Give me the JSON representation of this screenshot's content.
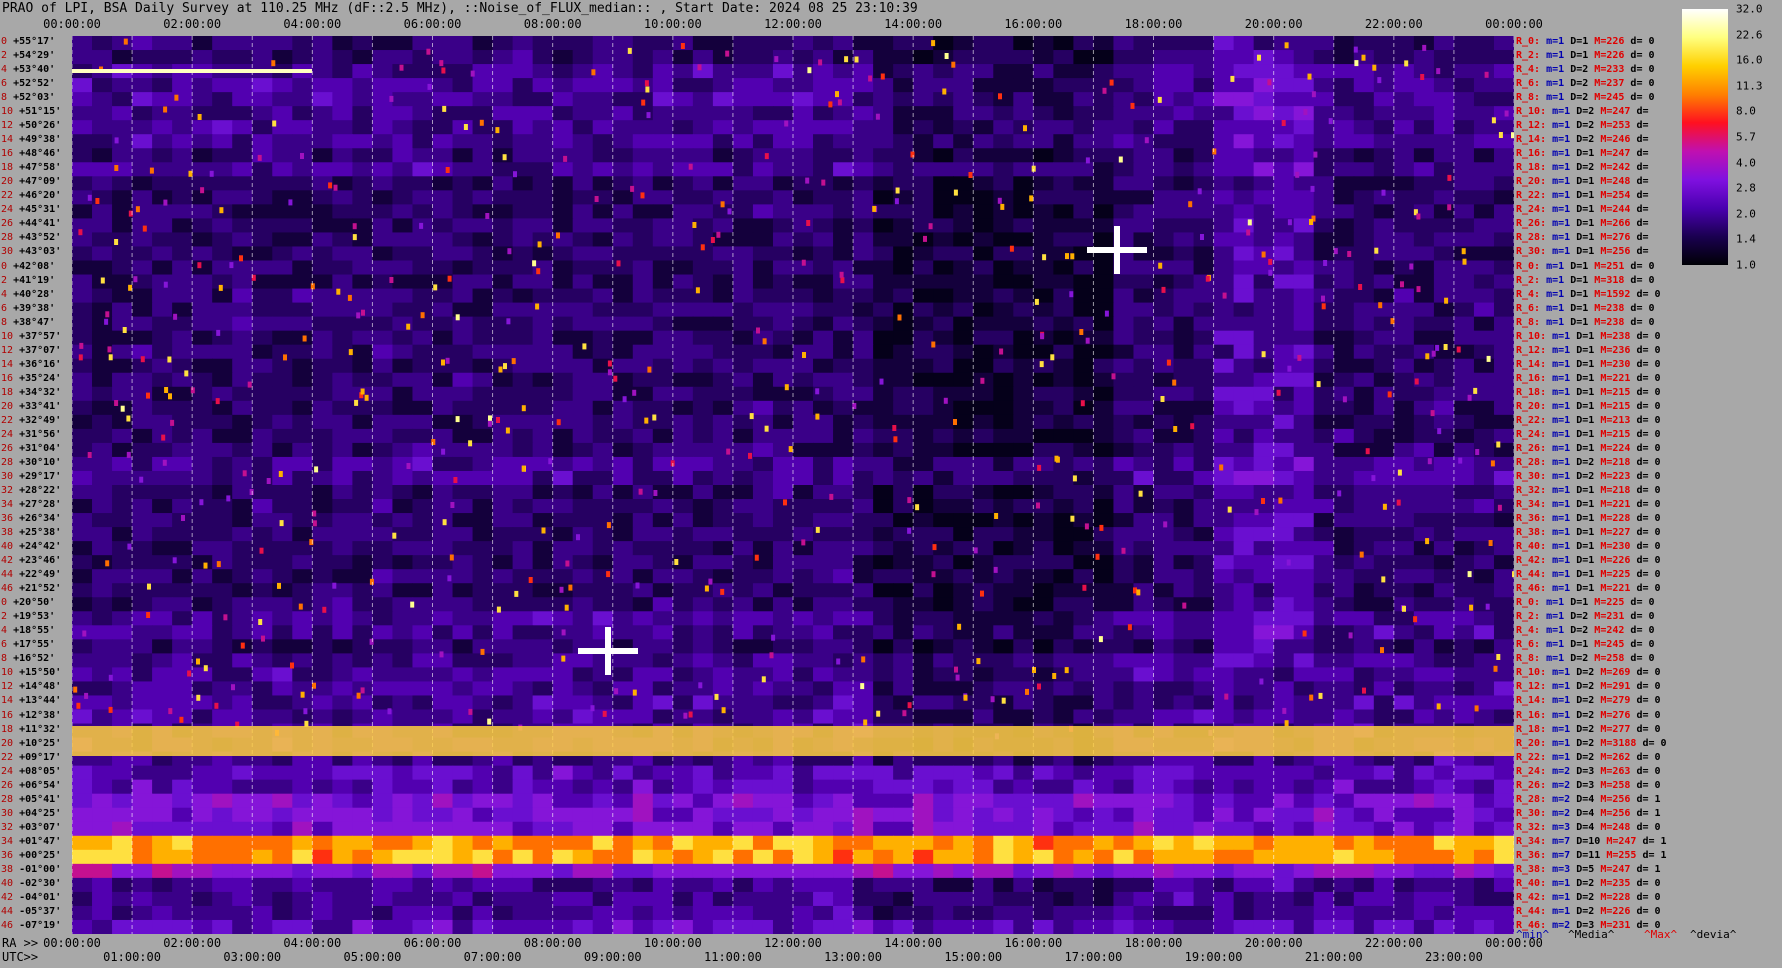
{
  "title": "PRAO of LPI, BSA Daily Survey at 110.25 MHz (dF::2.5 MHz), ::Noise_of_FLUX_median:: , Start Date: 2024 08 25 23:10:39",
  "ra_prefix": "RA >>",
  "utc_prefix": "UTC>>",
  "top_ticks": [
    "00:00:00",
    "02:00:00",
    "04:00:00",
    "06:00:00",
    "08:00:00",
    "10:00:00",
    "12:00:00",
    "14:00:00",
    "16:00:00",
    "18:00:00",
    "20:00:00",
    "22:00:00",
    "00:00:00"
  ],
  "ra_ticks": [
    "00:00:00",
    "02:00:00",
    "04:00:00",
    "06:00:00",
    "08:00:00",
    "10:00:00",
    "12:00:00",
    "14:00:00",
    "16:00:00",
    "18:00:00",
    "20:00:00",
    "22:00:00",
    "00:00:00"
  ],
  "utc_ticks": [
    "01:00:00",
    "03:00:00",
    "05:00:00",
    "07:00:00",
    "09:00:00",
    "11:00:00",
    "13:00:00",
    "15:00:00",
    "17:00:00",
    "19:00:00",
    "21:00:00",
    "23:00:00"
  ],
  "colorbar": {
    "labels": [
      "32.0",
      "22.6",
      "16.0",
      "11.3",
      "8.0",
      "5.7",
      "4.0",
      "2.8",
      "2.0",
      "1.4",
      "1.0"
    ]
  },
  "legend": {
    "min": "^min^",
    "median": "^Media^",
    "max": "^Max^",
    "devia": "^devia^"
  },
  "chart_data": {
    "type": "heatmap",
    "title": "PRAO of LPI, BSA Daily Survey at 110.25 MHz (dF::2.5 MHz), ::Noise_of_FLUX_median:: , Start Date: 2024 08 25 23:10:39",
    "x_axis": "RA / UTC",
    "dec_labels": [
      "+55°17'",
      "+54°29'",
      "+53°40'",
      "+52°52'",
      "+52°03'",
      "+51°15'",
      "+50°26'",
      "+49°38'",
      "+48°46'",
      "+47°58'",
      "+47°09'",
      "+46°20'",
      "+45°31'",
      "+44°41'",
      "+43°52'",
      "+43°03'",
      "+42°08'",
      "+41°19'",
      "+40°28'",
      "+39°38'",
      "+38°47'",
      "+37°57'",
      "+37°07'",
      "+36°16'",
      "+35°24'",
      "+34°32'",
      "+33°41'",
      "+32°49'",
      "+31°56'",
      "+31°04'",
      "+30°10'",
      "+29°17'",
      "+28°22'",
      "+27°28'",
      "+26°34'",
      "+25°38'",
      "+24°42'",
      "+23°46'",
      "+22°49'",
      "+21°52'",
      "+20°50'",
      "+19°53'",
      "+18°55'",
      "+17°55'",
      "+16°52'",
      "+15°50'",
      "+14°48'",
      "+13°44'",
      "+12°38'",
      "+11°32'",
      "+10°25'",
      "+09°17'",
      "+08°05'",
      "+06°54'",
      "+05°41'",
      "+04°25'",
      "+03°07'",
      "+01°47'",
      "+00°25'",
      "-01°00'",
      "-02°30'",
      "-04°01'",
      "-05°37'",
      "-07°19'"
    ],
    "row_indices": [
      "0",
      "2",
      "4",
      "6",
      "8",
      "10",
      "12",
      "14",
      "16",
      "18",
      "20",
      "22",
      "24",
      "26",
      "28",
      "30",
      "0",
      "2",
      "4",
      "6",
      "8",
      "10",
      "12",
      "14",
      "16",
      "18",
      "20",
      "22",
      "24",
      "26",
      "28",
      "30",
      "32",
      "34",
      "36",
      "38",
      "40",
      "42",
      "44",
      "46",
      "0",
      "2",
      "4",
      "6",
      "8",
      "10",
      "12",
      "14",
      "16",
      "18",
      "20",
      "22",
      "24",
      "26",
      "28",
      "30",
      "32",
      "34",
      "36",
      "38",
      "40",
      "42",
      "44",
      "46"
    ],
    "colorbar_values": [
      32.0,
      22.6,
      16.0,
      11.3,
      8.0,
      5.7,
      4.0,
      2.8,
      2.0,
      1.4,
      1.0
    ],
    "row_stats": [
      {
        "r": "R_0:",
        "m": 1,
        "D": 1,
        "M": 226,
        "d": "0"
      },
      {
        "r": "R_2:",
        "m": 1,
        "D": 1,
        "M": 226,
        "d": "0"
      },
      {
        "r": "R_4:",
        "m": 1,
        "D": 2,
        "M": 233,
        "d": "0"
      },
      {
        "r": "R_6:",
        "m": 1,
        "D": 2,
        "M": 237,
        "d": "0"
      },
      {
        "r": "R_8:",
        "m": 1,
        "D": 2,
        "M": 245,
        "d": "0"
      },
      {
        "r": "R_10:",
        "m": 1,
        "D": 2,
        "M": 247,
        "d": ""
      },
      {
        "r": "R_12:",
        "m": 1,
        "D": 2,
        "M": 253,
        "d": ""
      },
      {
        "r": "R_14:",
        "m": 1,
        "D": 2,
        "M": 246,
        "d": ""
      },
      {
        "r": "R_16:",
        "m": 1,
        "D": 1,
        "M": 247,
        "d": ""
      },
      {
        "r": "R_18:",
        "m": 1,
        "D": 2,
        "M": 242,
        "d": ""
      },
      {
        "r": "R_20:",
        "m": 1,
        "D": 1,
        "M": 248,
        "d": ""
      },
      {
        "r": "R_22:",
        "m": 1,
        "D": 1,
        "M": 254,
        "d": ""
      },
      {
        "r": "R_24:",
        "m": 1,
        "D": 1,
        "M": 244,
        "d": ""
      },
      {
        "r": "R_26:",
        "m": 1,
        "D": 1,
        "M": 266,
        "d": ""
      },
      {
        "r": "R_28:",
        "m": 1,
        "D": 1,
        "M": 276,
        "d": ""
      },
      {
        "r": "R_30:",
        "m": 1,
        "D": 1,
        "M": 256,
        "d": ""
      },
      {
        "r": "R_0:",
        "m": 1,
        "D": 1,
        "M": 251,
        "d": "0"
      },
      {
        "r": "R_2:",
        "m": 1,
        "D": 1,
        "M": 318,
        "d": "0"
      },
      {
        "r": "R_4:",
        "m": 1,
        "D": 1,
        "M": 1592,
        "d": "0"
      },
      {
        "r": "R_6:",
        "m": 1,
        "D": 1,
        "M": 238,
        "d": "0"
      },
      {
        "r": "R_8:",
        "m": 1,
        "D": 1,
        "M": 238,
        "d": "0"
      },
      {
        "r": "R_10:",
        "m": 1,
        "D": 1,
        "M": 238,
        "d": "0"
      },
      {
        "r": "R_12:",
        "m": 1,
        "D": 1,
        "M": 236,
        "d": "0"
      },
      {
        "r": "R_14:",
        "m": 1,
        "D": 1,
        "M": 230,
        "d": "0"
      },
      {
        "r": "R_16:",
        "m": 1,
        "D": 1,
        "M": 221,
        "d": "0"
      },
      {
        "r": "R_18:",
        "m": 1,
        "D": 1,
        "M": 215,
        "d": "0"
      },
      {
        "r": "R_20:",
        "m": 1,
        "D": 1,
        "M": 215,
        "d": "0"
      },
      {
        "r": "R_22:",
        "m": 1,
        "D": 1,
        "M": 213,
        "d": "0"
      },
      {
        "r": "R_24:",
        "m": 1,
        "D": 1,
        "M": 215,
        "d": "0"
      },
      {
        "r": "R_26:",
        "m": 1,
        "D": 1,
        "M": 224,
        "d": "0"
      },
      {
        "r": "R_28:",
        "m": 1,
        "D": 2,
        "M": 218,
        "d": "0"
      },
      {
        "r": "R_30:",
        "m": 1,
        "D": 2,
        "M": 223,
        "d": "0"
      },
      {
        "r": "R_32:",
        "m": 1,
        "D": 1,
        "M": 218,
        "d": "0"
      },
      {
        "r": "R_34:",
        "m": 1,
        "D": 1,
        "M": 221,
        "d": "0"
      },
      {
        "r": "R_36:",
        "m": 1,
        "D": 1,
        "M": 228,
        "d": "0"
      },
      {
        "r": "R_38:",
        "m": 1,
        "D": 1,
        "M": 227,
        "d": "0"
      },
      {
        "r": "R_40:",
        "m": 1,
        "D": 1,
        "M": 230,
        "d": "0"
      },
      {
        "r": "R_42:",
        "m": 1,
        "D": 1,
        "M": 226,
        "d": "0"
      },
      {
        "r": "R_44:",
        "m": 1,
        "D": 1,
        "M": 225,
        "d": "0"
      },
      {
        "r": "R_46:",
        "m": 1,
        "D": 1,
        "M": 221,
        "d": "0"
      },
      {
        "r": "R_0:",
        "m": 1,
        "D": 1,
        "M": 225,
        "d": "0"
      },
      {
        "r": "R_2:",
        "m": 1,
        "D": 2,
        "M": 231,
        "d": "0"
      },
      {
        "r": "R_4:",
        "m": 1,
        "D": 2,
        "M": 242,
        "d": "0"
      },
      {
        "r": "R_6:",
        "m": 1,
        "D": 1,
        "M": 245,
        "d": "0"
      },
      {
        "r": "R_8:",
        "m": 1,
        "D": 2,
        "M": 258,
        "d": "0"
      },
      {
        "r": "R_10:",
        "m": 1,
        "D": 2,
        "M": 269,
        "d": "0"
      },
      {
        "r": "R_12:",
        "m": 1,
        "D": 2,
        "M": 291,
        "d": "0"
      },
      {
        "r": "R_14:",
        "m": 1,
        "D": 2,
        "M": 279,
        "d": "0"
      },
      {
        "r": "R_16:",
        "m": 1,
        "D": 2,
        "M": 276,
        "d": "0"
      },
      {
        "r": "R_18:",
        "m": 1,
        "D": 2,
        "M": 277,
        "d": "0"
      },
      {
        "r": "R_20:",
        "m": 1,
        "D": 2,
        "M": 3188,
        "d": "0"
      },
      {
        "r": "R_22:",
        "m": 1,
        "D": 2,
        "M": 262,
        "d": "0"
      },
      {
        "r": "R_24:",
        "m": 2,
        "D": 3,
        "M": 263,
        "d": "0"
      },
      {
        "r": "R_26:",
        "m": 2,
        "D": 3,
        "M": 258,
        "d": "0"
      },
      {
        "r": "R_28:",
        "m": 2,
        "D": 4,
        "M": 256,
        "d": "1"
      },
      {
        "r": "R_30:",
        "m": 2,
        "D": 4,
        "M": 256,
        "d": "1"
      },
      {
        "r": "R_32:",
        "m": 3,
        "D": 4,
        "M": 248,
        "d": "0"
      },
      {
        "r": "R_34:",
        "m": 7,
        "D": 10,
        "M": 247,
        "d": "1"
      },
      {
        "r": "R_36:",
        "m": 7,
        "D": 11,
        "M": 255,
        "d": "1"
      },
      {
        "r": "R_38:",
        "m": 3,
        "D": 5,
        "M": 247,
        "d": "1"
      },
      {
        "r": "R_40:",
        "m": 1,
        "D": 2,
        "M": 235,
        "d": "0"
      },
      {
        "r": "R_42:",
        "m": 1,
        "D": 2,
        "M": 228,
        "d": "0"
      },
      {
        "r": "R_44:",
        "m": 1,
        "D": 2,
        "M": 226,
        "d": "0"
      },
      {
        "r": "R_46:",
        "m": 2,
        "D": 3,
        "M": 231,
        "d": "0"
      }
    ]
  }
}
